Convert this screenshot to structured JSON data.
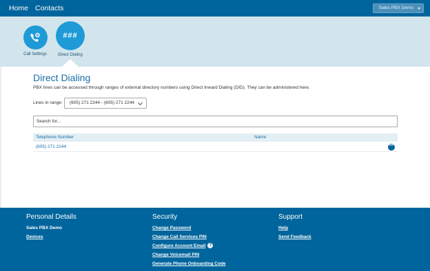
{
  "nav": {
    "home": "Home",
    "contacts": "Contacts",
    "account": "Sales PBX Demo"
  },
  "band": {
    "tiles": [
      {
        "label": "Call Settings",
        "icon": "phone-gear-icon"
      },
      {
        "label": "Direct Dialing",
        "icon": "hash-icon",
        "glyph": "###"
      }
    ]
  },
  "main": {
    "title": "Direct Dialing",
    "description": "PBX lines can be accessed through ranges of external directory numbers using Direct Inward Dialing (DID). They can be administered here.",
    "range_label": "Lines in range:",
    "range_value": "(605) 271 2244 - (605) 271 2244",
    "search_placeholder": "Search for...",
    "columns": [
      "Telephone Number",
      "Name"
    ],
    "rows": [
      {
        "number": "(605) 271 2244",
        "name": ""
      }
    ],
    "more_glyph": "•••"
  },
  "footer": {
    "personal": {
      "title": "Personal Details",
      "items": [
        "Sales PBX Demo",
        "Devices"
      ]
    },
    "security": {
      "title": "Security",
      "items": [
        "Change Password",
        "Change Call Services PIN",
        "Configure Account Email",
        "Change Voicemail PIN",
        "Generate Phone Onboarding Code"
      ]
    },
    "support": {
      "title": "Support",
      "items": [
        "Help",
        "Send Feedback"
      ]
    }
  },
  "colors": {
    "brand": "#00659c",
    "accent": "#1e9ad6",
    "band": "#d2e5ed",
    "title": "#1a6ea5"
  }
}
